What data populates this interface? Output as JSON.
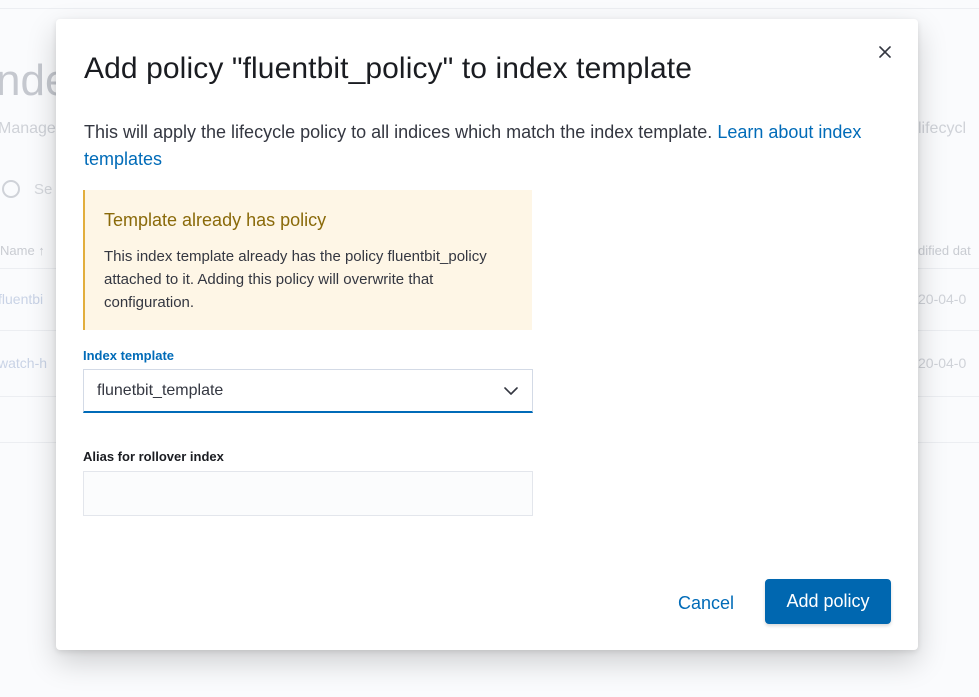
{
  "background": {
    "title_fragment": "nde",
    "subtitle_fragment_left": "Manage",
    "subtitle_fragment_right": "lifecycl",
    "search_fragment": "Se",
    "column_name": "Name ↑",
    "column_modified": "dified dat",
    "rows": [
      {
        "name_fragment": "fluentbi",
        "date_fragment": "20-04-0"
      },
      {
        "name_fragment": "watch-h",
        "date_fragment": "20-04-0"
      }
    ]
  },
  "modal": {
    "title": "Add policy \"fluentbit_policy\" to index template",
    "description": "This will apply the lifecycle policy to all indices which match the index template.",
    "learn_more_link": "Learn about index templates",
    "callout": {
      "title": "Template already has policy",
      "body": "This index template already has the policy fluentbit_policy attached to it. Adding this policy will overwrite that configuration."
    },
    "index_template": {
      "label": "Index template",
      "selected_value": "flunetbit_template"
    },
    "alias": {
      "label": "Alias for rollover index",
      "value": "",
      "placeholder": ""
    },
    "cancel_label": "Cancel",
    "submit_label": "Add policy"
  },
  "colors": {
    "primary": "#0067b0",
    "link": "#006bb8",
    "warning_bg": "#fef6e6",
    "warning_border": "#e2ae3d",
    "warning_title": "#8a6a0a"
  },
  "icons": {
    "close": "close-icon",
    "select_arrow": "chevron-down-icon",
    "search": "search-icon"
  }
}
